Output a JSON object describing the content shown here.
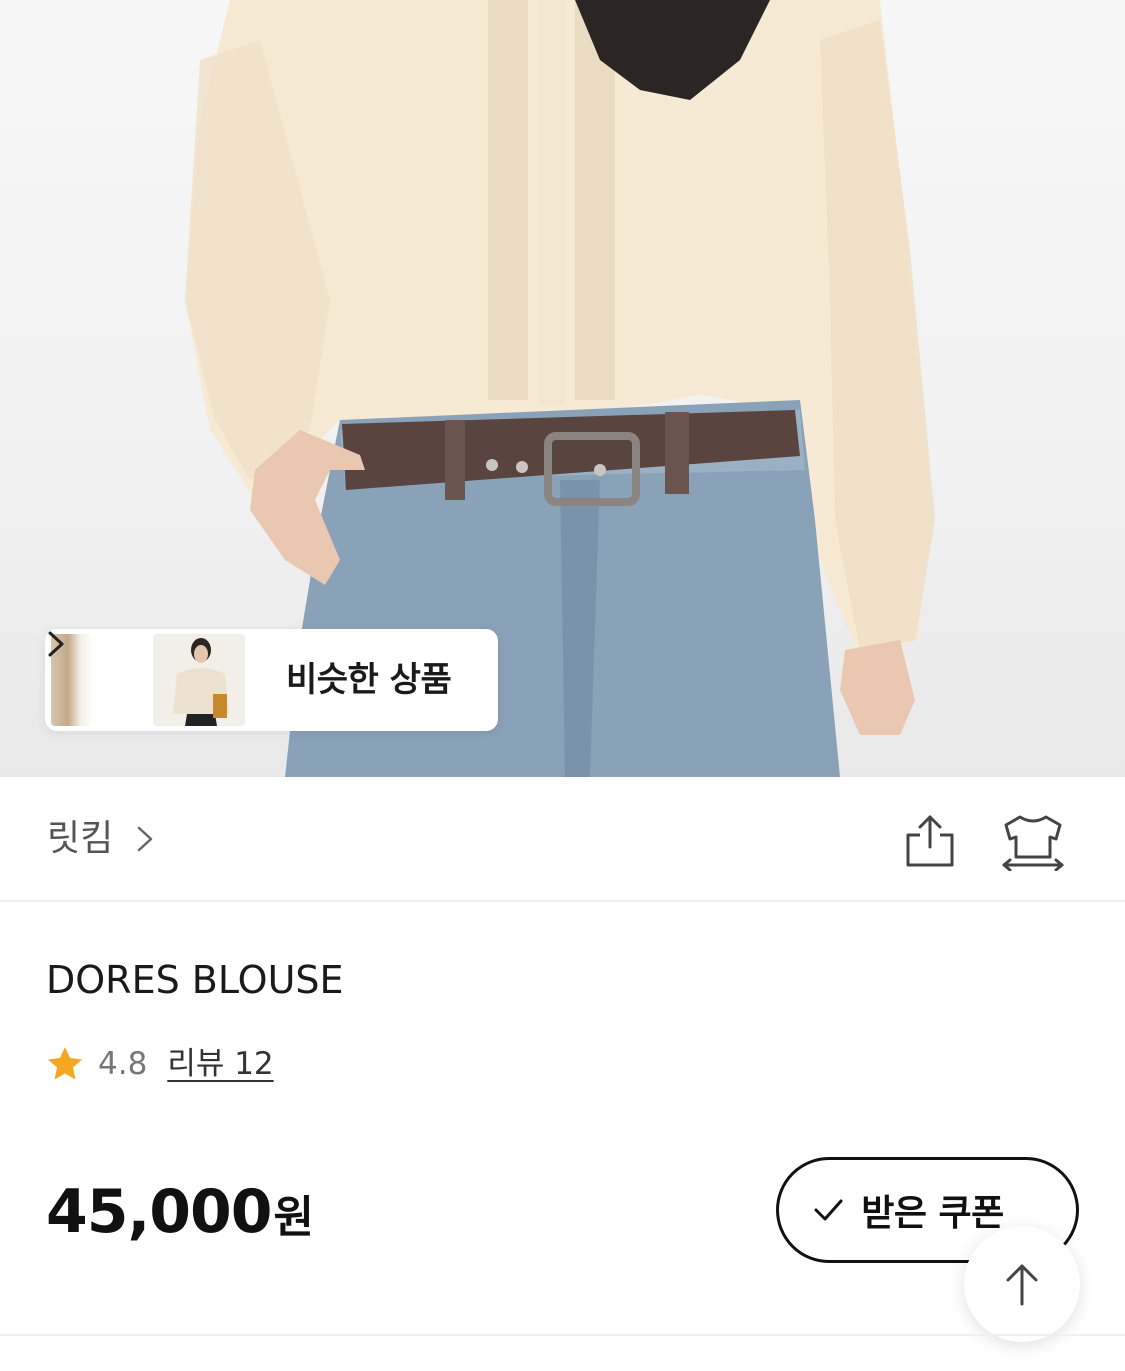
{
  "hero": {
    "similar": {
      "label": "비슷한 상품"
    }
  },
  "brand": {
    "name": "릿킴"
  },
  "product": {
    "title": "DORES BLOUSE",
    "rating": "4.8",
    "review_link": "리뷰 12",
    "price": "45,000",
    "price_unit": "원"
  },
  "coupon": {
    "label": "받은 쿠폰"
  },
  "icons": {
    "share": "share-icon",
    "size": "size-guide-icon",
    "star": "star-icon",
    "check": "check-icon",
    "scroll_top": "arrow-up-icon",
    "chevron": "chevron-right-icon"
  },
  "colors": {
    "star": "#F5A623",
    "text_primary": "#111111",
    "text_secondary": "#777777",
    "divider": "#F0F0F0"
  }
}
